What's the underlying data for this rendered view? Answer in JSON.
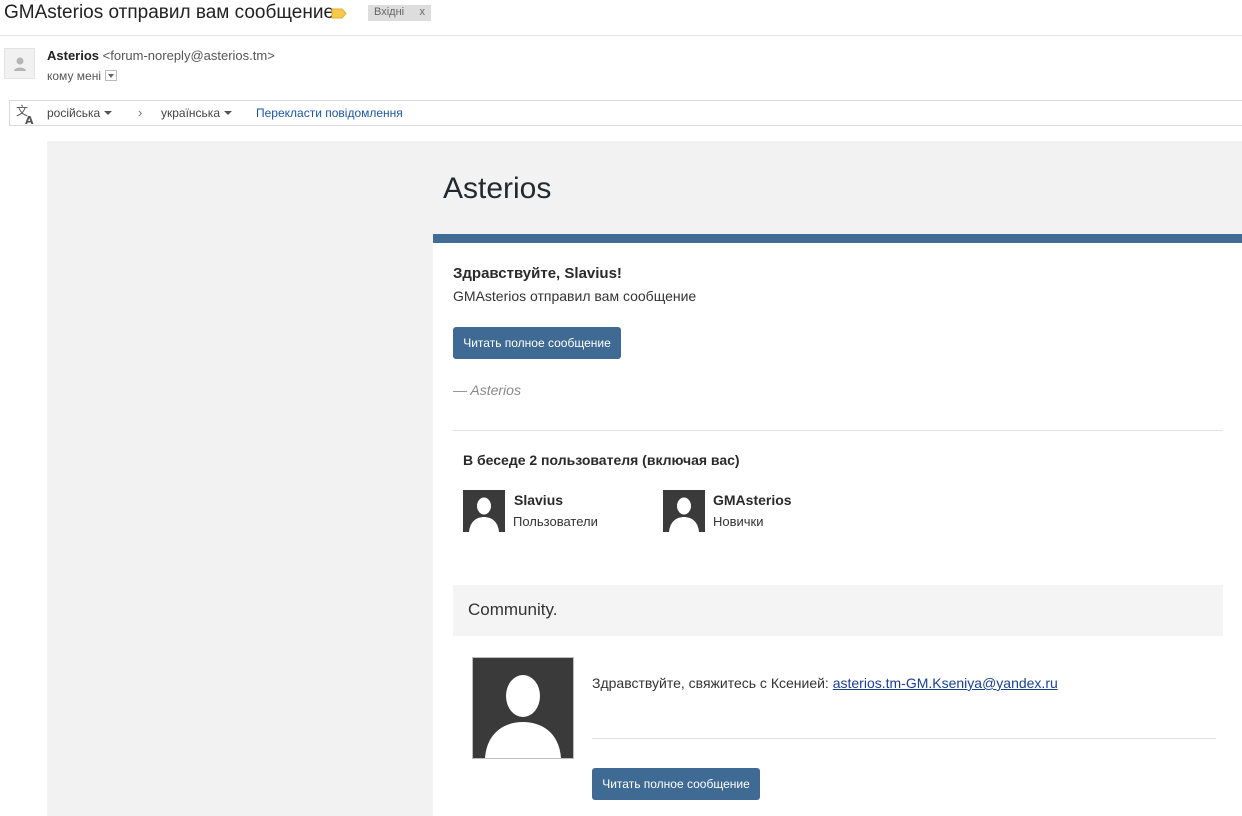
{
  "header": {
    "subject": "GMAsterios отправил вам сообщение",
    "inbox_chip": "Вхідні",
    "inbox_chip_close": "x",
    "label_color": "#f8c94a"
  },
  "sender": {
    "name": "Asterios",
    "email": "<forum-noreply@asterios.tm>",
    "to": "кому мені"
  },
  "translate": {
    "from_lang": "російська",
    "arrow": "›",
    "to_lang": "українська",
    "action": "Перекласти повідомлення"
  },
  "email": {
    "brand": "Asterios",
    "accent_color": "#416c96",
    "greeting": "Здравствуйте, Slavius!",
    "greeting_sub": "GMAsterios отправил вам сообщение",
    "read_button": "Читать полное сообщение",
    "signature": "— Asterios",
    "conversation_title": "В беседе 2 пользователя (включая вас)",
    "participants": [
      {
        "name": "Slavius",
        "group": "Пользователи"
      },
      {
        "name": "GMAsterios",
        "group": "Новички"
      }
    ],
    "community_title": "Community.",
    "contact_text": "Здравствуйте, свяжитесь с Ксенией: ",
    "contact_link": "asterios.tm-GM.Kseniya@yandex.ru",
    "read_button_2": "Читать полное сообщение"
  }
}
